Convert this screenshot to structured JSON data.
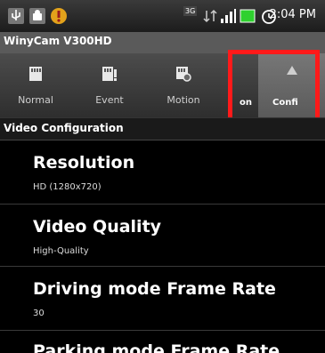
{
  "statusbar": {
    "time": "2:04 PM",
    "network": "3G"
  },
  "app": {
    "title": "WinyCam V300HD"
  },
  "tabs": [
    {
      "label": "Normal"
    },
    {
      "label": "Event"
    },
    {
      "label": "Motion"
    },
    {
      "label": "on"
    },
    {
      "label": "Confi"
    }
  ],
  "section": {
    "title": "Video Configuration"
  },
  "settings": [
    {
      "title": "Resolution",
      "value": "HD (1280x720)"
    },
    {
      "title": "Video Quality",
      "value": "High-Quality"
    },
    {
      "title": "Driving mode Frame Rate",
      "value": "30"
    },
    {
      "title": "Parking mode Frame Rate",
      "value": ""
    }
  ],
  "highlight_color": "#ff1a1a"
}
